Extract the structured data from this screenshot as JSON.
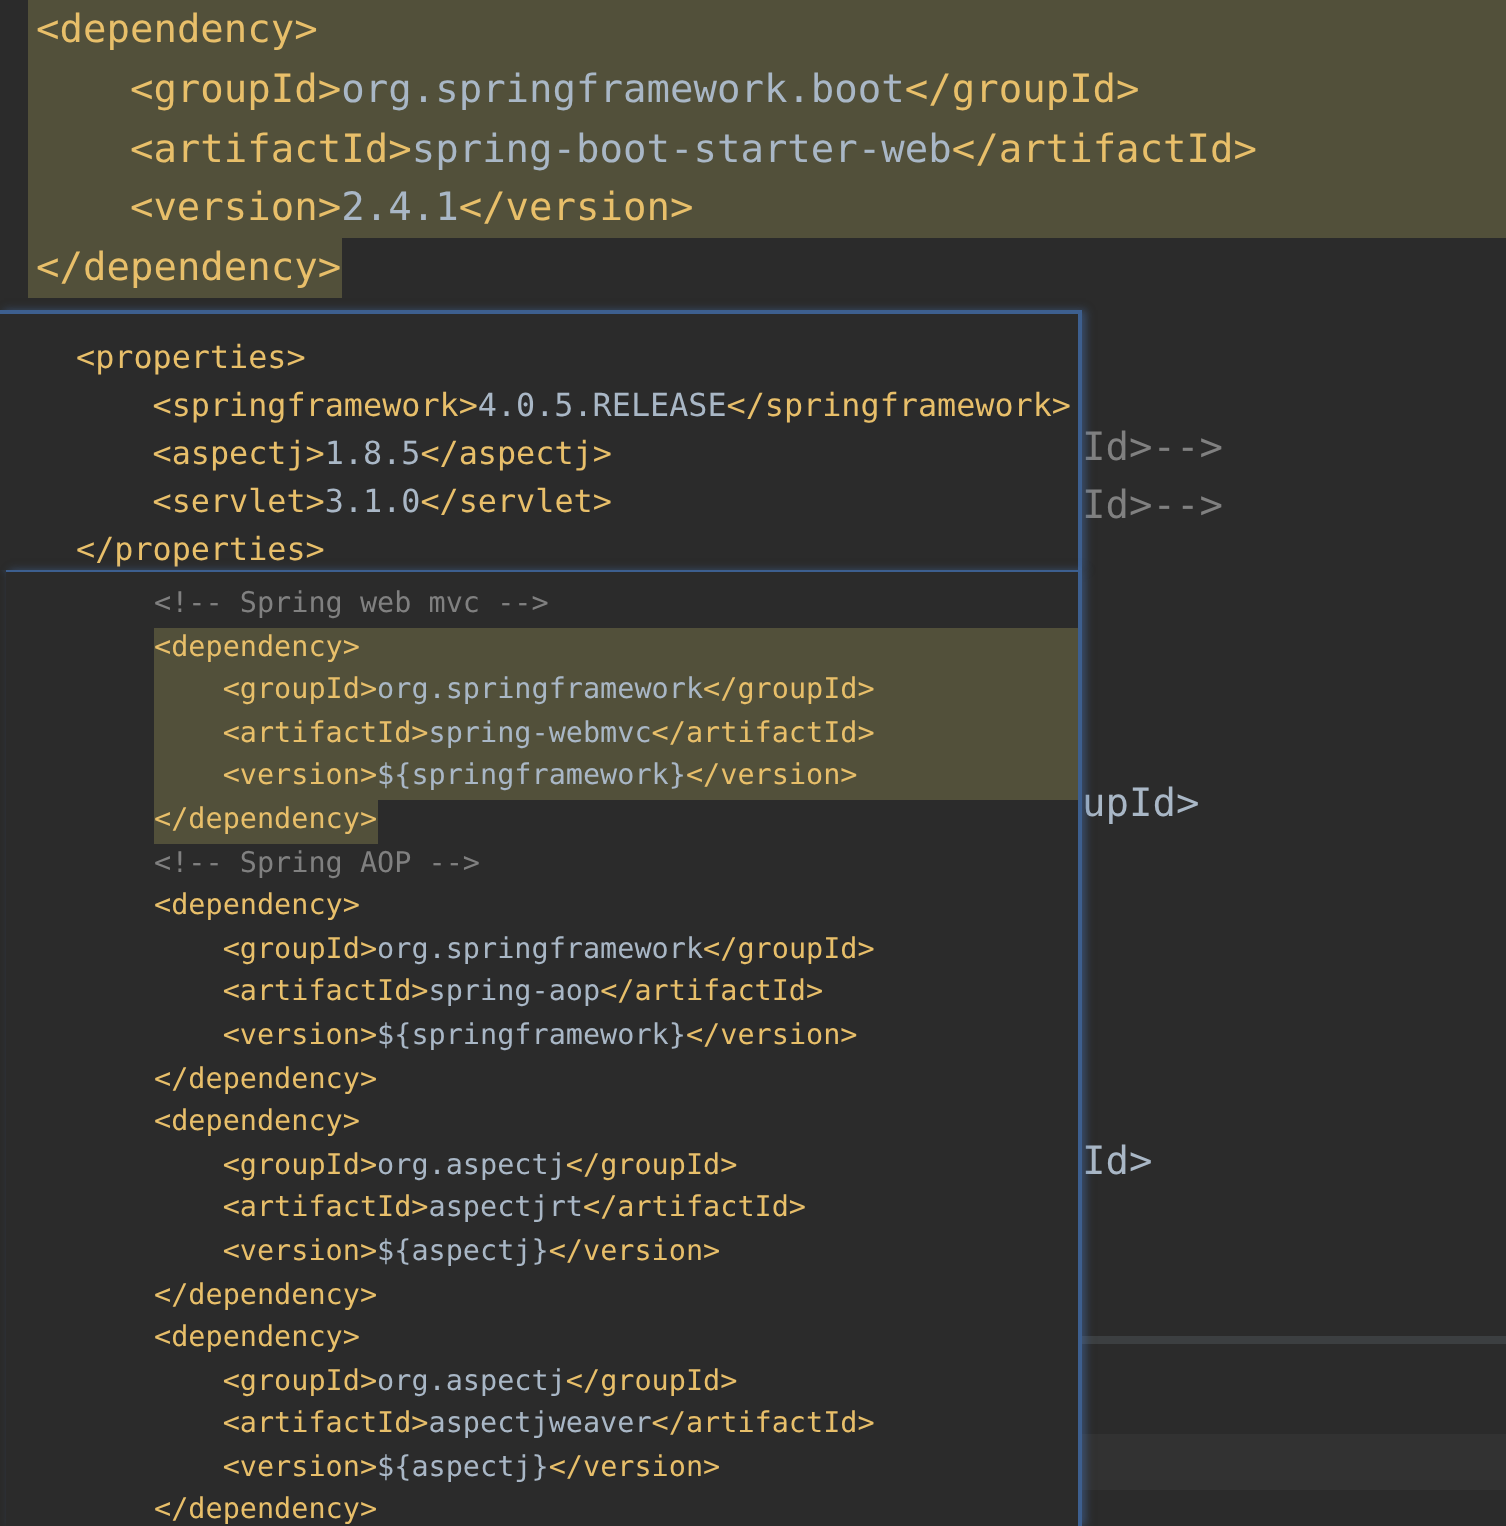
{
  "editor": {
    "lines": [
      {
        "text": "<dependency>",
        "highlighted": true,
        "children": [
          {
            "text": "<groupId>org.springframework.boot</groupId>",
            "highlighted": true
          },
          {
            "text": "<artifactId>spring-boot-starter-web</artifactId>",
            "highlighted": true
          },
          {
            "text": "<version>2.4.1</version>",
            "highlighted": true
          }
        ]
      },
      {
        "text": "</dependency>",
        "highlighted": true
      }
    ],
    "fragments": [
      {
        "text": "Id>-->",
        "kind": "comment"
      },
      {
        "text": "Id>-->",
        "kind": "comment"
      },
      {
        "text": "upId>",
        "kind": "tag"
      },
      {
        "text": "Id>",
        "kind": "tag"
      }
    ]
  },
  "popups": [
    {
      "lines": [
        {
          "text": "<properties>",
          "children": [
            {
              "text": "<springframework>4.0.5.RELEASE</springframework>"
            },
            {
              "text": "<aspectj>1.8.5</aspectj>"
            },
            {
              "text": "<servlet>3.1.0</servlet>"
            }
          ]
        },
        {
          "text": "</properties>"
        }
      ]
    },
    {
      "lines": [
        {
          "text": "<!-- Spring web mvc -->",
          "kind": "comment"
        },
        {
          "text": "<dependency>",
          "highlighted": true,
          "children": [
            {
              "text": "<groupId>org.springframework</groupId>",
              "highlighted": true
            },
            {
              "text": "<artifactId>spring-webmvc</artifactId>",
              "highlighted": true
            },
            {
              "text": "<version>${springframework}</version>",
              "highlighted": true
            }
          ]
        },
        {
          "text": "</dependency>",
          "highlighted": true
        },
        {
          "text": "<!-- Spring AOP -->",
          "kind": "comment"
        },
        {
          "text": "<dependency>",
          "children": [
            {
              "text": "<groupId>org.springframework</groupId>"
            },
            {
              "text": "<artifactId>spring-aop</artifactId>"
            },
            {
              "text": "<version>${springframework}</version>"
            }
          ]
        },
        {
          "text": "</dependency>"
        },
        {
          "text": "<dependency>",
          "children": [
            {
              "text": "<groupId>org.aspectj</groupId>"
            },
            {
              "text": "<artifactId>aspectjrt</artifactId>"
            },
            {
              "text": "<version>${aspectj}</version>"
            }
          ]
        },
        {
          "text": "</dependency>"
        },
        {
          "text": "<dependency>",
          "children": [
            {
              "text": "<groupId>org.aspectj</groupId>"
            },
            {
              "text": "<artifactId>aspectjweaver</artifactId>"
            },
            {
              "text": "<version>${aspectj}</version>"
            }
          ]
        },
        {
          "text": "</dependency>"
        }
      ]
    }
  ]
}
